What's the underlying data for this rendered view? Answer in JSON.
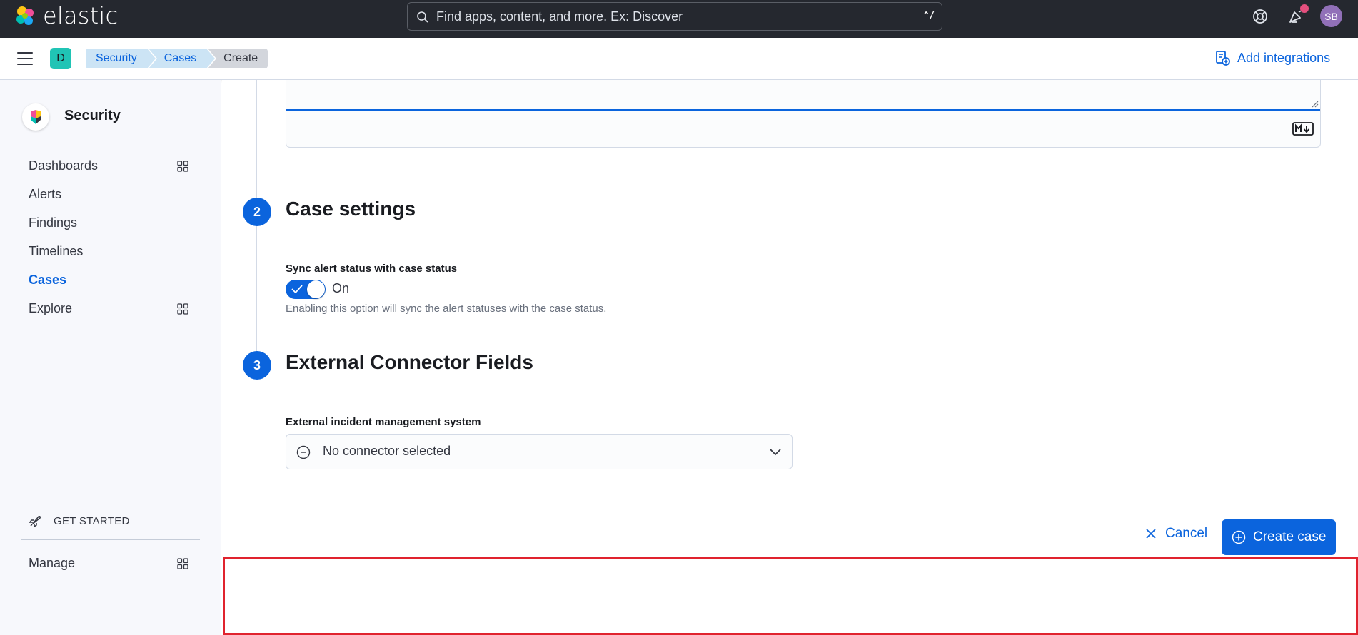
{
  "header": {
    "brand": "elastic",
    "search_placeholder": "Find apps, content, and more. Ex: Discover",
    "search_shortcut": "^/",
    "avatar_initials": "SB"
  },
  "subheader": {
    "space_initial": "D",
    "breadcrumbs": [
      "Security",
      "Cases",
      "Create"
    ],
    "add_integrations": "Add integrations"
  },
  "sidebar": {
    "title": "Security",
    "items": [
      {
        "label": "Dashboards",
        "grid": true
      },
      {
        "label": "Alerts",
        "grid": false
      },
      {
        "label": "Findings",
        "grid": false
      },
      {
        "label": "Timelines",
        "grid": false
      },
      {
        "label": "Cases",
        "grid": false,
        "active": true
      },
      {
        "label": "Explore",
        "grid": true
      }
    ],
    "get_started": "GET STARTED",
    "manage": "Manage"
  },
  "form": {
    "step2": {
      "number": "2",
      "title": "Case settings"
    },
    "sync_label": "Sync alert status with case status",
    "toggle_state": "On",
    "sync_help": "Enabling this option will sync the alert statuses with the case status.",
    "step3": {
      "number": "3",
      "title": "External Connector Fields"
    },
    "connector_label": "External incident management system",
    "connector_value": "No connector selected",
    "cancel": "Cancel",
    "create": "Create case"
  },
  "colors": {
    "accent": "#0b64dd",
    "header_bg": "#25282f",
    "highlight": "#e0232e"
  }
}
